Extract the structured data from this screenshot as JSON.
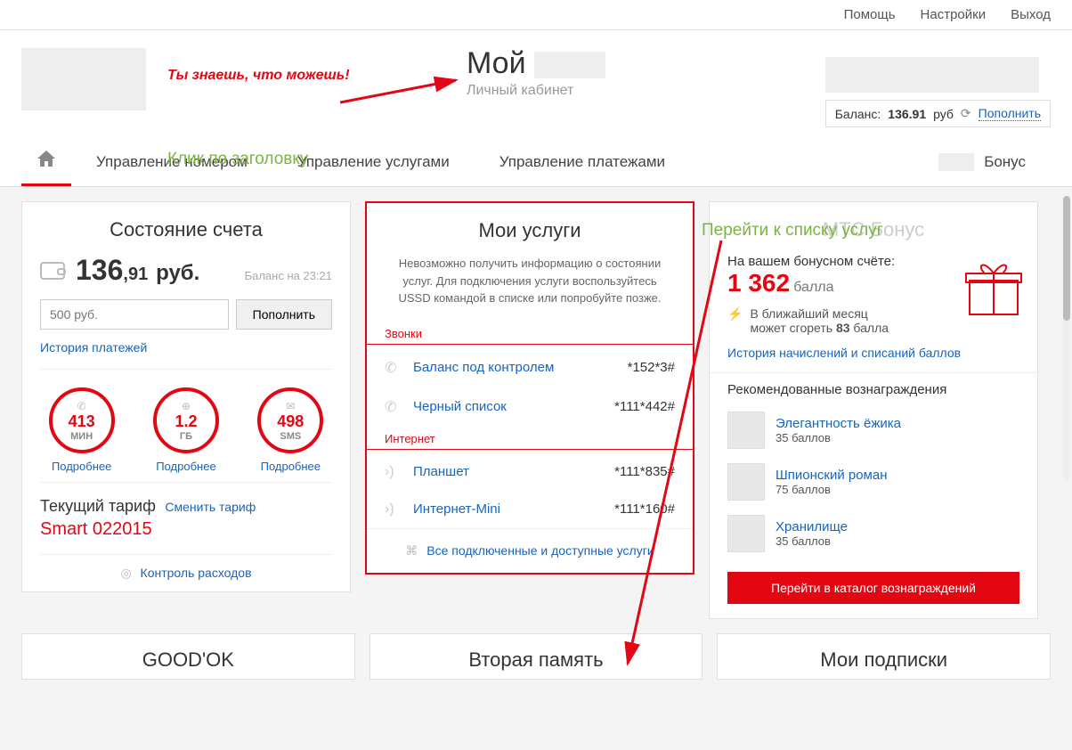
{
  "topbar": {
    "help": "Помощь",
    "settings": "Настройки",
    "logout": "Выход"
  },
  "header": {
    "slogan": "Ты знаешь, что можешь!",
    "title_prefix": "Мой",
    "subtitle": "Личный кабинет",
    "balance_label": "Баланс:",
    "balance_value": "136.91",
    "balance_currency": "руб",
    "topup": "Пополнить"
  },
  "annotations": {
    "click_header": "Клик по заголовку",
    "go_services": "Перейти к списку услуг"
  },
  "nav": {
    "number": "Управление номером",
    "services": "Управление услугами",
    "payments": "Управление платежами",
    "bonus": "Бонус"
  },
  "account": {
    "title": "Состояние счета",
    "amount_int": "136",
    "amount_dec": ",91",
    "currency": "руб.",
    "balance_at": "Баланс на 23:21",
    "input_placeholder": "500 руб.",
    "topup_btn": "Пополнить",
    "history": "История платежей",
    "circles": [
      {
        "icon": "phone",
        "value": "413",
        "unit": "МИН",
        "more": "Подробнее"
      },
      {
        "icon": "globe",
        "value": "1.2",
        "unit": "ГБ",
        "more": "Подробнее"
      },
      {
        "icon": "mail",
        "value": "498",
        "unit": "SMS",
        "more": "Подробнее"
      }
    ],
    "tariff_label": "Текущий тариф",
    "tariff_change": "Сменить тариф",
    "tariff_name": "Smart 022015",
    "expenses": "Контроль расходов"
  },
  "services": {
    "title": "Мои услуги",
    "message": "Невозможно получить информацию о состоянии услуг. Для подключения услуги воспользуйтесь USSD командой в списке или попробуйте позже.",
    "cat_calls": "Звонки",
    "calls": [
      {
        "name": "Баланс под контролем",
        "ussd": "*152*3#"
      },
      {
        "name": "Черный список",
        "ussd": "*111*442#"
      }
    ],
    "cat_internet": "Интернет",
    "internet": [
      {
        "name": "Планшет",
        "ussd": "*111*835#"
      },
      {
        "name": "Интернет-Mini",
        "ussd": "*111*160#"
      }
    ],
    "all": "Все подключенные и доступные услуги"
  },
  "bonus": {
    "title": "МТС Бонус",
    "on_account": "На вашем бонусном счёте:",
    "amount": "1 362",
    "unit": "балла",
    "burn_line1": "В ближайший месяц",
    "burn_line2_prefix": "может сгореть ",
    "burn_value": "83",
    "burn_line2_suffix": " балла",
    "history": "История начислений и списаний баллов",
    "rewards_title": "Рекомендованные вознаграждения",
    "rewards": [
      {
        "name": "Элегантность ёжика",
        "price": "35 баллов"
      },
      {
        "name": "Шпионский роман",
        "price": "75 баллов"
      },
      {
        "name": "Хранилище",
        "price": "35 баллов"
      }
    ],
    "catalog_btn": "Перейти в каталог вознаграждений"
  },
  "row2": {
    "goodok": "GOOD'OK",
    "memory": "Вторая память",
    "subs": "Мои подписки"
  }
}
